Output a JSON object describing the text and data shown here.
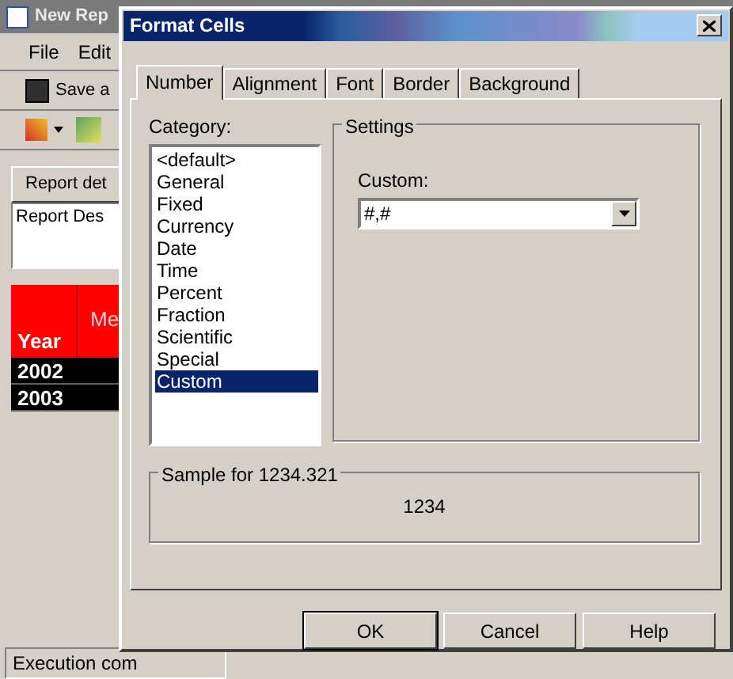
{
  "app": {
    "title": "New Rep",
    "menu": [
      "File",
      "Edit"
    ],
    "toolbar_button": "Save a",
    "panel_tab": "Report det",
    "description": "Report Des",
    "grid": {
      "header_cut": "Me",
      "header": "Year",
      "rows": [
        "2002",
        "2003"
      ]
    },
    "status_bar": [
      "Execution com"
    ]
  },
  "dialog": {
    "title": "Format Cells",
    "tabs": [
      {
        "label": "Number",
        "selected": true
      },
      {
        "label": "Alignment",
        "selected": false
      },
      {
        "label": "Font",
        "selected": false
      },
      {
        "label": "Border",
        "selected": false
      },
      {
        "label": "Background",
        "selected": false
      }
    ],
    "category_label": "Category:",
    "categories": [
      {
        "label": "<default>",
        "selected": false
      },
      {
        "label": "General",
        "selected": false
      },
      {
        "label": "Fixed",
        "selected": false
      },
      {
        "label": "Currency",
        "selected": false
      },
      {
        "label": "Date",
        "selected": false
      },
      {
        "label": "Time",
        "selected": false
      },
      {
        "label": "Percent",
        "selected": false
      },
      {
        "label": "Fraction",
        "selected": false
      },
      {
        "label": "Scientific",
        "selected": false
      },
      {
        "label": "Special",
        "selected": false
      },
      {
        "label": "Custom",
        "selected": true
      }
    ],
    "settings": {
      "title": "Settings",
      "custom_label": "Custom:",
      "custom_value": "#,#"
    },
    "sample": {
      "title": "Sample for 1234.321",
      "value": "1234"
    },
    "buttons": [
      {
        "label": "OK",
        "default": true
      },
      {
        "label": "Cancel",
        "default": false
      },
      {
        "label": "Help",
        "default": false
      }
    ]
  }
}
